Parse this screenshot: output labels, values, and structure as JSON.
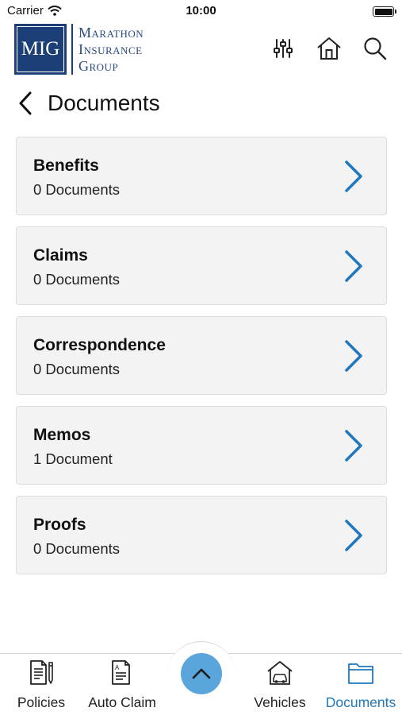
{
  "status_bar": {
    "carrier": "Carrier",
    "time": "10:00"
  },
  "header": {
    "logo_mark": "MIG",
    "logo_lines": [
      "Marathon",
      "Insurance",
      "Group"
    ],
    "icons": [
      "sliders-icon",
      "home-icon",
      "search-icon"
    ]
  },
  "page": {
    "title": "Documents"
  },
  "categories": [
    {
      "title": "Benefits",
      "count": "0 Documents"
    },
    {
      "title": "Claims",
      "count": "0 Documents"
    },
    {
      "title": "Correspondence",
      "count": "0 Documents"
    },
    {
      "title": "Memos",
      "count": "1 Document"
    },
    {
      "title": "Proofs",
      "count": "0 Documents"
    }
  ],
  "bottom_nav": {
    "items": [
      {
        "label": "Policies",
        "icon": "policies-icon",
        "active": false
      },
      {
        "label": "Auto Claim",
        "icon": "auto-claim-icon",
        "active": false
      },
      {
        "label": "Vehicles",
        "icon": "vehicles-icon",
        "active": false
      },
      {
        "label": "Documents",
        "icon": "folder-icon",
        "active": true
      }
    ],
    "center_button_icon": "chevron-up-icon"
  },
  "colors": {
    "brand_navy": "#1d3f77",
    "accent_blue": "#1f77bd",
    "fab_blue": "#5aa6dc",
    "card_bg": "#f3f3f4"
  }
}
